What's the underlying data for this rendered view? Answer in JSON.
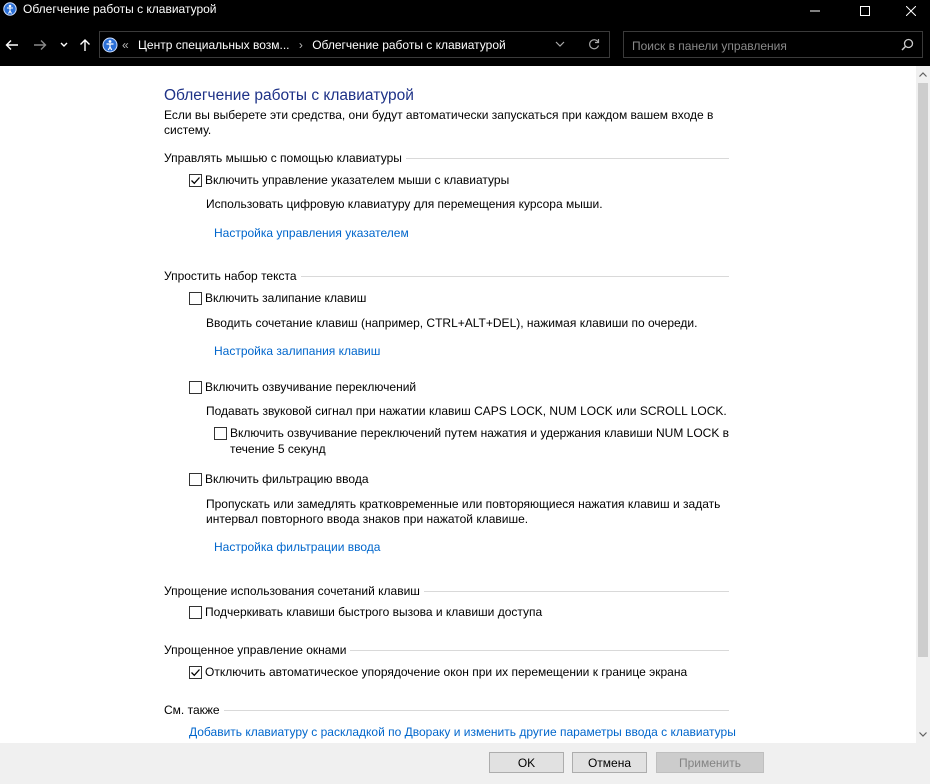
{
  "window": {
    "title": "Облегчение работы с клавиатурой"
  },
  "nav": {
    "breadcrumb": [
      "Центр специальных возм...",
      "Облегчение работы с клавиатурой"
    ],
    "search_placeholder": "Поиск в панели управления"
  },
  "page": {
    "heading": "Облегчение работы с клавиатурой",
    "intro_line1": "Если вы выберете эти средства, они будут автоматически запускаться при каждом вашем входе в",
    "intro_line2": "систему."
  },
  "sections": {
    "mouse": {
      "header": "Управлять мышью с помощью клавиатуры",
      "option_label": "Включить управление указателем мыши с клавиатуры",
      "option_checked": true,
      "description": "Использовать цифровую клавиатуру для перемещения курсора мыши.",
      "link": "Настройка управления указателем"
    },
    "typing": {
      "header": "Упростить набор текста",
      "sticky_label": "Включить залипание клавиш",
      "sticky_checked": false,
      "sticky_desc": "Вводить сочетание клавиш (например, CTRL+ALT+DEL), нажимая клавиши по очереди.",
      "sticky_link": "Настройка залипания клавиш",
      "toggle_label": "Включить озвучивание переключений",
      "toggle_checked": false,
      "toggle_desc": "Подавать звуковой сигнал при нажатии клавиш CAPS LOCK, NUM LOCK или SCROLL LOCK.",
      "toggle_sub_line1": "Включить озвучивание переключений путем нажатия и удержания клавиши NUM LOCK в",
      "toggle_sub_line2": "течение 5 секунд",
      "toggle_sub_checked": false,
      "filter_label": "Включить фильтрацию ввода",
      "filter_checked": false,
      "filter_desc1": "Пропускать или замедлять кратковременные или повторяющиеся нажатия клавиш и задать",
      "filter_desc2": "интервал повторного ввода знаков при нажатой клавише.",
      "filter_link": "Настройка фильтрации ввода"
    },
    "shortcuts": {
      "header": "Упрощение использования сочетаний клавиш",
      "option_label": "Подчеркивать клавиши быстрого вызова и клавиши доступа",
      "option_checked": false
    },
    "windows": {
      "header": "Упрощенное управление окнами",
      "option_label": "Отключить автоматическое упорядочение окон при их перемещении к границе экрана",
      "option_checked": true
    },
    "see_also": {
      "header": "См. также",
      "link": "Добавить клавиатуру с раскладкой по Двораку и изменить другие параметры ввода с клавиатуры"
    }
  },
  "buttons": {
    "ok": "OK",
    "cancel": "Отмена",
    "apply": "Применить"
  }
}
